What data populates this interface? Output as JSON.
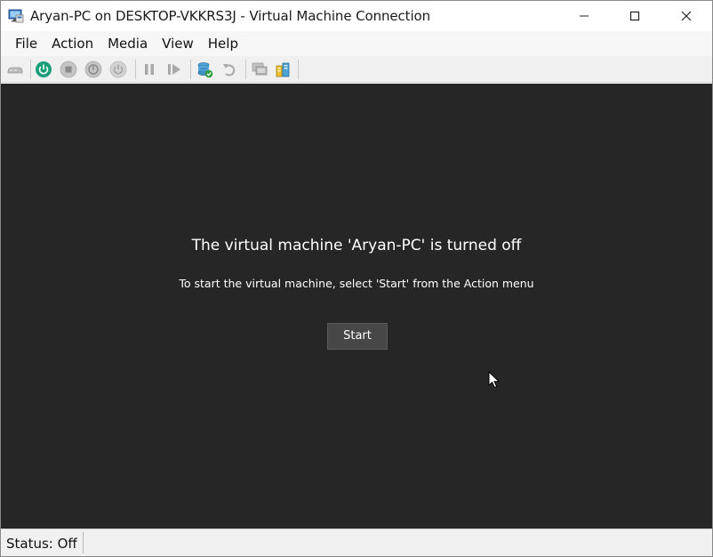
{
  "window": {
    "title": "Aryan-PC on DESKTOP-VKKRS3J - Virtual Machine Connection"
  },
  "menu": {
    "items": [
      "File",
      "Action",
      "Media",
      "View",
      "Help"
    ]
  },
  "toolbar": {
    "icons": [
      "ctrl-alt-del-icon",
      "start-icon",
      "turn-off-icon",
      "shut-down-icon",
      "save-icon",
      "pause-icon",
      "resume-icon",
      "checkpoint-icon",
      "revert-icon",
      "enhanced-session-icon",
      "share-icon"
    ]
  },
  "vm": {
    "message_title": "The virtual machine 'Aryan-PC' is turned off",
    "message_sub": "To start the virtual machine, select 'Start' from the Action menu",
    "start_label": "Start"
  },
  "status": {
    "text": "Status: Off"
  },
  "colors": {
    "main_bg": "#262626",
    "accent_green": "#1b9f7a"
  }
}
